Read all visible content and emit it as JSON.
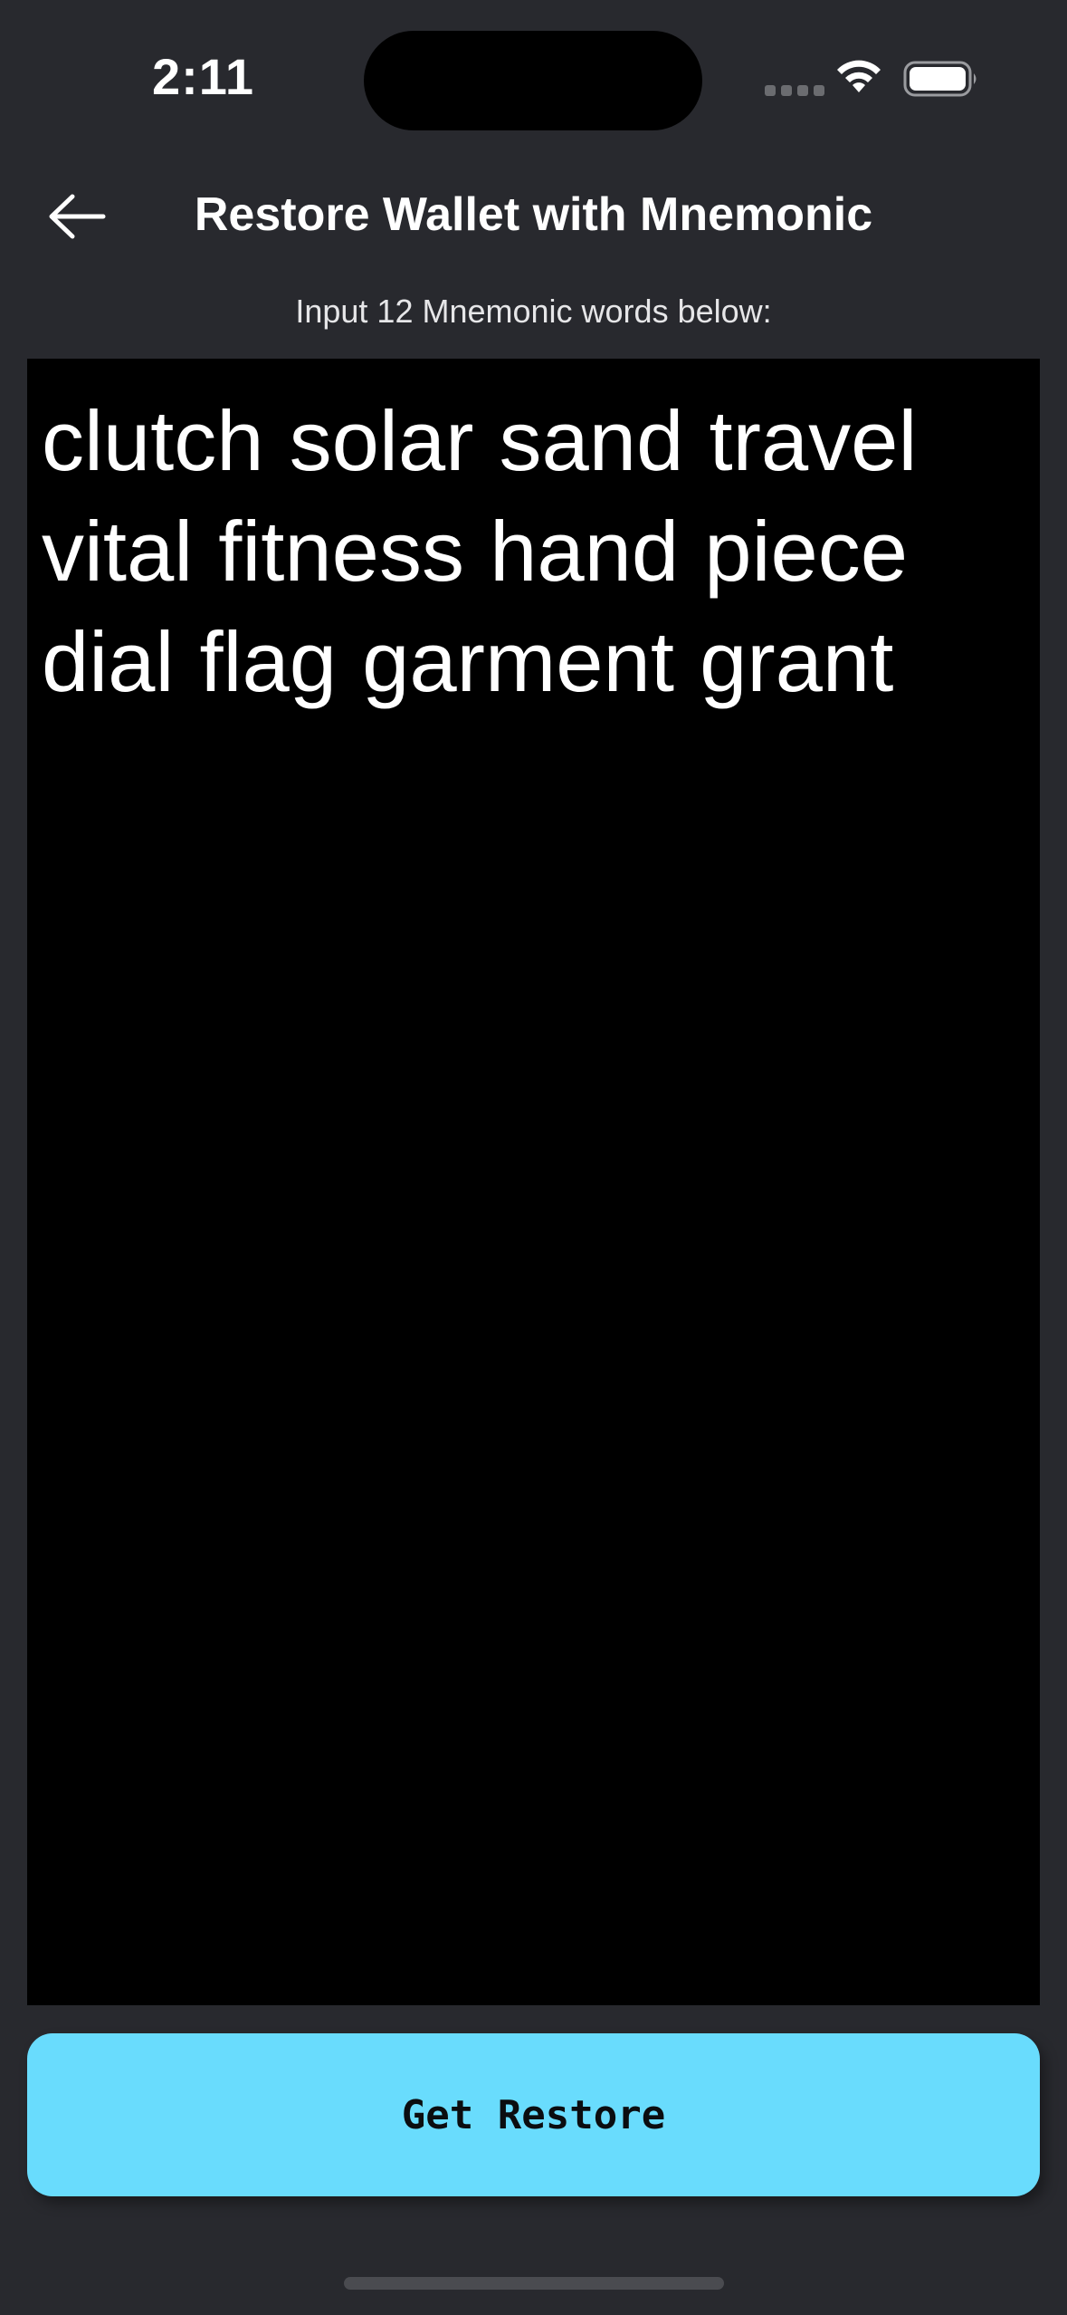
{
  "status_bar": {
    "time": "2:11",
    "icons": [
      "cellular-signal-icon",
      "wifi-icon",
      "battery-icon"
    ]
  },
  "nav": {
    "back_icon": "arrow-left-icon",
    "title": "Restore Wallet with Mnemonic"
  },
  "instruction": "Input 12 Mnemonic words below:",
  "mnemonic": {
    "value": "clutch solar sand travel vital fitness hand piece dial flag garment grant"
  },
  "actions": {
    "restore_label": "Get Restore"
  },
  "colors": {
    "background": "#28292e",
    "input_background": "#000000",
    "button_accent": "#69dcfd",
    "text": "#ffffff"
  }
}
